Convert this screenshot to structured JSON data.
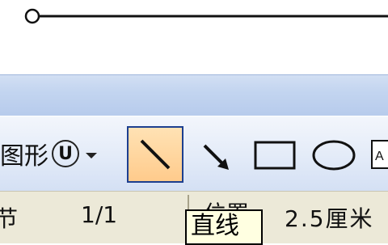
{
  "toolbar": {
    "autoshapes_label": "图形",
    "autoshapes_badge": "U",
    "tools": [
      {
        "name": "line-tool",
        "selected": true
      },
      {
        "name": "arrow-tool",
        "selected": false
      },
      {
        "name": "rectangle-tool",
        "selected": false
      },
      {
        "name": "oval-tool",
        "selected": false
      },
      {
        "name": "textbox-tool",
        "selected": false
      }
    ]
  },
  "statusbar": {
    "section": "节",
    "page": "1/1",
    "position_label": "位置",
    "position_value": "2.5厘米"
  },
  "tooltip": {
    "text": "直线"
  },
  "colors": {
    "selected_fill": "#ffcb8c",
    "selected_border": "#1c3f8f",
    "toolbar_bg": "#e3ebf8",
    "statusbar_bg": "#ece9d8",
    "tooltip_bg": "#ffffe1"
  }
}
